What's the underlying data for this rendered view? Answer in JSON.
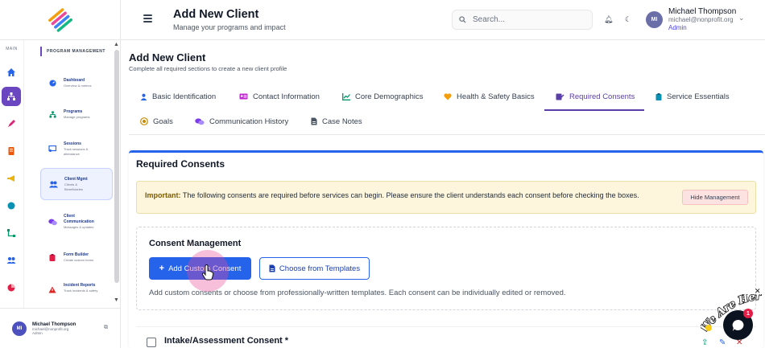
{
  "header": {
    "title": "Add New Client",
    "subtitle": "Manage your programs and impact",
    "search_placeholder": "Search...",
    "user": {
      "initials": "MI",
      "name": "Michael Thompson",
      "email": "michael@nonprofit.org",
      "role": "Admin"
    }
  },
  "rail": {
    "label": "MAIN"
  },
  "sidebar": {
    "section_title": "PROGRAM MANAGEMENT",
    "items": [
      {
        "title": "Dashboard",
        "desc": "Overview & metrics"
      },
      {
        "title": "Programs",
        "desc": "Manage programs"
      },
      {
        "title": "Sessions",
        "desc": "Track sessions & attendance"
      },
      {
        "title": "Client Mgmt",
        "desc": "Clients & Beneficiaries"
      },
      {
        "title": "Client Communication",
        "desc": "Messages & updates"
      },
      {
        "title": "Form Builder",
        "desc": "Create custom forms"
      },
      {
        "title": "Incident Reports",
        "desc": "Track incidents & safety"
      }
    ],
    "footer": {
      "initials": "MI",
      "name": "Michael Thompson",
      "email": "michael@nonprofit.org",
      "role": "Admin"
    }
  },
  "page": {
    "title": "Add New Client",
    "subtitle": "Complete all required sections to create a new client profile"
  },
  "tabs": [
    {
      "label": "Basic Identification",
      "icon": "user-icon"
    },
    {
      "label": "Contact Information",
      "icon": "id-card-icon"
    },
    {
      "label": "Core Demographics",
      "icon": "chart-icon"
    },
    {
      "label": "Health & Safety Basics",
      "icon": "heart-icon"
    },
    {
      "label": "Required Consents",
      "icon": "signature-icon",
      "active": true
    },
    {
      "label": "Service Essentials",
      "icon": "clipboard-icon"
    },
    {
      "label": "Goals",
      "icon": "target-icon"
    },
    {
      "label": "Communication History",
      "icon": "comments-icon"
    },
    {
      "label": "Case Notes",
      "icon": "file-icon"
    }
  ],
  "card": {
    "title": "Required Consents",
    "alert_bold": "Important:",
    "alert_text": " The following consents are required before services can begin. Please ensure the client understands each consent before checking the boxes.",
    "hide_button": "Hide Management",
    "management": {
      "title": "Consent Management",
      "add_button": "Add Custom Consent",
      "template_button": "Choose from Templates",
      "help": "Add custom consents or choose from professionally-written templates. Each consent can be individually edited or removed."
    },
    "consent_item": {
      "label": "Intake/Assessment Consent *"
    }
  },
  "chat": {
    "badge": "1",
    "greeting": "We Are Here!"
  },
  "colors": {
    "accent": "#5b3fa8",
    "primary": "#2563eb",
    "alert_bg": "#fdf6dc",
    "danger": "#e11d48"
  }
}
